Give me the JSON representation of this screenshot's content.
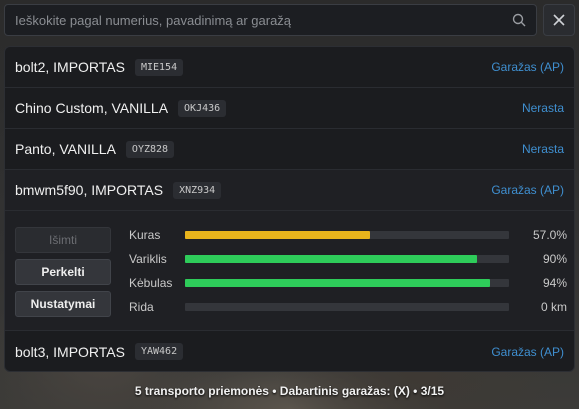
{
  "search": {
    "placeholder": "Ieškokite pagal numerius, pavadinimą ar garažą",
    "value": ""
  },
  "close_label": "✕",
  "vehicles": [
    {
      "name": "bolt2, IMPORTAS",
      "plate": "MIE154",
      "status": "Garažas (AP)"
    },
    {
      "name": "Chino Custom, VANILLA",
      "plate": "OKJ436",
      "status": "Nerasta"
    },
    {
      "name": "Panto, VANILLA",
      "plate": "OYZ828",
      "status": "Nerasta"
    },
    {
      "name": "bmwm5f90, IMPORTAS",
      "plate": "XNZ934",
      "status": "Garažas (AP)"
    },
    {
      "name": "bolt3, IMPORTAS",
      "plate": "YAW462",
      "status": "Garažas (AP)"
    }
  ],
  "details": {
    "buttons": {
      "take_out": "Išimti",
      "move": "Perkelti",
      "settings": "Nustatymai"
    },
    "stats": [
      {
        "label": "Kuras",
        "value": "57.0%",
        "fill": 0.57,
        "color": "#e8b41c"
      },
      {
        "label": "Variklis",
        "value": "90%",
        "fill": 0.9,
        "color": "#2ecc5a"
      },
      {
        "label": "Kėbulas",
        "value": "94%",
        "fill": 0.94,
        "color": "#2ecc5a"
      },
      {
        "label": "Rida",
        "value": "0 km",
        "fill": 0,
        "color": "#2ecc5a"
      }
    ]
  },
  "footer": "5 transporto priemonės • Dabartinis garažas: (X) • 3/15",
  "colors": {
    "accent": "#3f8fd0",
    "fuel": "#e8b41c",
    "health": "#2ecc5a"
  }
}
